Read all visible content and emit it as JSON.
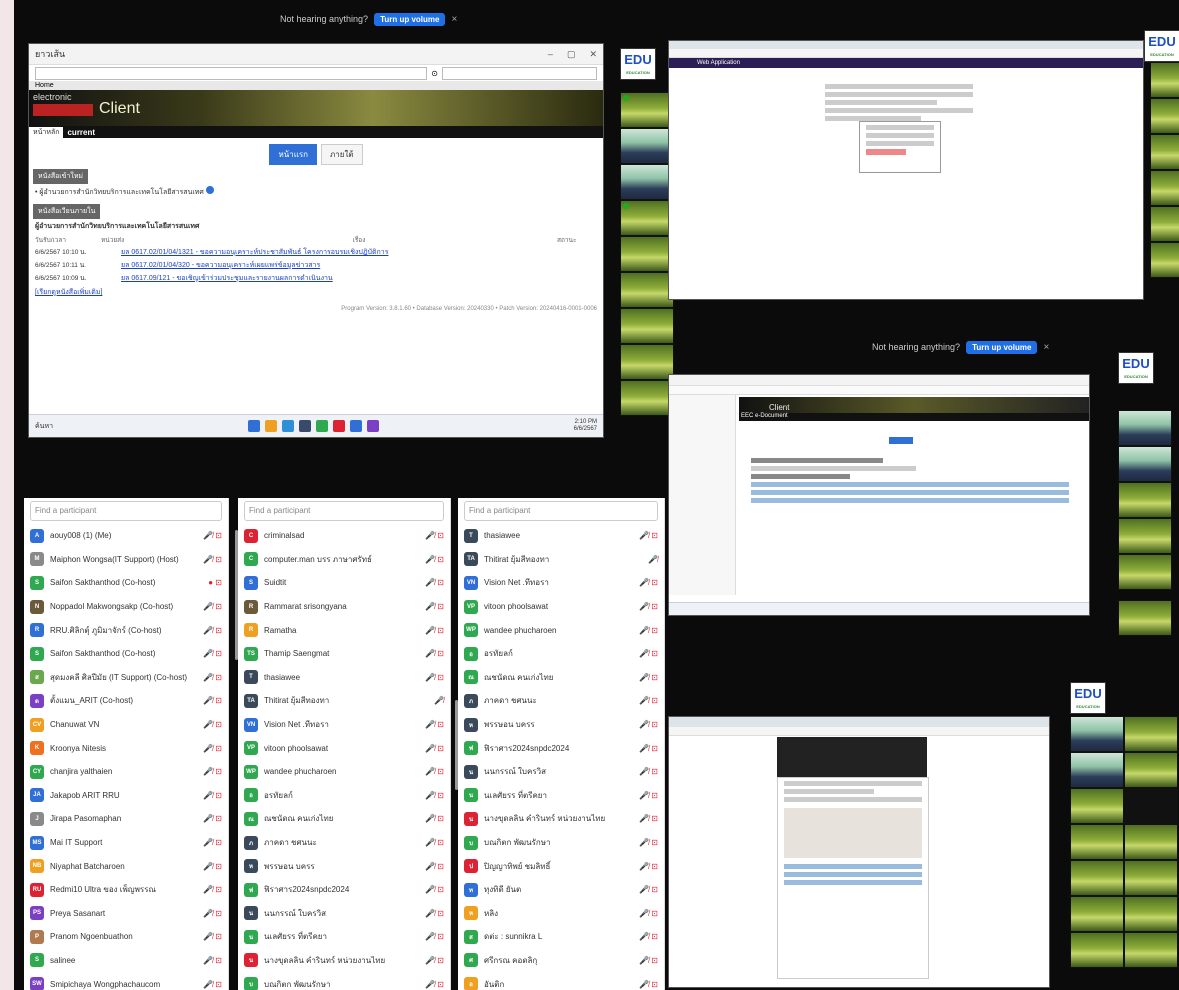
{
  "banner": {
    "text": "Not hearing anything?",
    "button": "Turn up volume",
    "close": "×"
  },
  "main_window": {
    "title": "ยาวเส้น",
    "address_glyph": "⊙",
    "tab_label": "Home",
    "ec_line1": "electronic",
    "ec_line2": "Client",
    "subheader_left": "หน้าหลัก",
    "subheader_right": "current",
    "tab1": "หน้าแรก",
    "tab2": "ภายใต้",
    "section1": "หนังสือเข้าใหม่",
    "notice": "ผู้อำนวยการสำนักวิทยบริการและเทคโนโลยีสารสนเทศ",
    "section2": "หนังสือเวียนภายใน",
    "table_title": "ผู้อำนวยการสำนักวิทยบริการและเทคโนโลยีสารสนเทศ",
    "col_date": "วันรับ/เวลา",
    "col_sender": "หน่วยส่ง",
    "col_subject": "เรื่อง",
    "col_status": "สถานะ",
    "rows": [
      {
        "date": "6/6/2567 10:10 น.",
        "link": "ยล 0617.02/01/04/1321 - ขอความอนุเคราะห์ประชาสัมพันธ์ โครงการอบรมเชิงปฏิบัติการ"
      },
      {
        "date": "6/6/2567 10:11 น.",
        "link": "ยล 0617.02/01/04/320 - ขอความอนุเคราะห์เผยแพร่ข้อมูลข่าวสาร"
      },
      {
        "date": "6/6/2567 10:09 น.",
        "link": "ยล 0617.09/121 - ขอเชิญเข้าร่วมประชุมและรายงานผลการดำเนินงาน"
      }
    ],
    "more_link": "[เรียกดูหนังสือเพิ่มเติม]",
    "version": "Program Version: 3.8.1.60 • Database Version: 20240330 • Patch Version: 20240416-0001-0006",
    "taskbar_search": "ค้นหา",
    "taskbar_time": "2:10 PM",
    "taskbar_date": "6/6/2567"
  },
  "right_window": {
    "header": "Web Application"
  },
  "mid_window": {
    "banner_header": "EEC e-Document",
    "ec_line2": "Client"
  },
  "edu_logo": {
    "text": "EDU",
    "sub": "EDUCATION"
  },
  "participants": {
    "search_placeholder": "Find a participant",
    "col1": [
      {
        "initials": "A",
        "name": "aouy008 (1) (Me)",
        "color": "#2f6fd6",
        "status": "🎤̸ ⊡"
      },
      {
        "initials": "M",
        "name": "Maiphon Wongsa(IT Support) (Host)",
        "color": "#8a8a8a",
        "status": "🎤̸ ⊡"
      },
      {
        "initials": "S",
        "name": "Saifon Sakthanthod (Co-host)",
        "color": "#2fa84f",
        "status": "● ⊡"
      },
      {
        "initials": "N",
        "name": "Noppadol Makwongsakp (Co-host)",
        "color": "#6b5a3a",
        "status": "🎤̸ ⊡"
      },
      {
        "initials": "R",
        "name": "RRU.ศิลิกตุ์ ภูมิมาจักร์ (Co-host)",
        "color": "#2f6fd6",
        "status": "🎤̸ ⊡"
      },
      {
        "initials": "S",
        "name": "Saifon Sakthanthod (Co-host)",
        "color": "#2fa84f",
        "status": "🎤̸ ⊡"
      },
      {
        "initials": "ส",
        "name": "สุดมงคลี ศิลปีมัย (IT Support) (Co-host)",
        "color": "#6aa84f",
        "status": "🎤̸ ⊡"
      },
      {
        "initials": "ต",
        "name": "ตั้งแมน_ARIT (Co-host)",
        "color": "#7b3fc4",
        "status": "🎤̸ ⊡"
      },
      {
        "initials": "CV",
        "name": "Chanuwat VN",
        "color": "#f0a020",
        "status": "🎤̸ ⊡"
      },
      {
        "initials": "K",
        "name": "Kroonya Nitesis",
        "color": "#f07020",
        "status": "🎤̸ ⊡"
      },
      {
        "initials": "CY",
        "name": "chanjira yalthaien",
        "color": "#2fa84f",
        "status": "🎤̸ ⊡"
      },
      {
        "initials": "JA",
        "name": "Jakapob ARIT RRU",
        "color": "#2f6fd6",
        "status": "🎤̸ ⊡"
      },
      {
        "initials": "J",
        "name": "Jirapa Pasomaphan",
        "color": "#8a8a8a",
        "status": "🎤̸ ⊡"
      },
      {
        "initials": "MS",
        "name": "Mai IT Support",
        "color": "#2f6fd6",
        "status": "🎤̸ ⊡"
      },
      {
        "initials": "NB",
        "name": "Niyaphat Batcharoen",
        "color": "#f0a020",
        "status": "🎤̸ ⊡"
      },
      {
        "initials": "RU",
        "name": "Redmi10 Ultra ของ เพ็ญพรรณ",
        "color": "#d23",
        "status": "🎤̸ ⊡"
      },
      {
        "initials": "PS",
        "name": "Preya Sasanart",
        "color": "#7b3fc4",
        "status": "🎤̸ ⊡"
      },
      {
        "initials": "P",
        "name": "Pranom Ngoenbuathon",
        "color": "#b07a50",
        "status": "🎤̸ ⊡"
      },
      {
        "initials": "S",
        "name": "salinee",
        "color": "#2fa84f",
        "status": "🎤̸ ⊡"
      },
      {
        "initials": "SW",
        "name": "Smipichaya Wongphachaucom",
        "color": "#7b3fc4",
        "status": "🎤̸ ⊡"
      }
    ],
    "col2": [
      {
        "initials": "C",
        "name": "criminalsad",
        "color": "#d23",
        "status": "🎤̸ ⊡"
      },
      {
        "initials": "C",
        "name": "computer.man บรร ภาษาศรัทธ์",
        "color": "#2fa84f",
        "status": "🎤̸ ⊡"
      },
      {
        "initials": "S",
        "name": "Suidtit",
        "color": "#2f6fd6",
        "status": "🎤̸ ⊡"
      },
      {
        "initials": "R",
        "name": "Rammarat srisongyana",
        "color": "#6b5a3a",
        "status": "🎤̸ ⊡"
      },
      {
        "initials": "R",
        "name": "Ramatha",
        "color": "#f0a020",
        "status": "🎤̸ ⊡"
      },
      {
        "initials": "TS",
        "name": "Thamip Saengmat",
        "color": "#2fa84f",
        "status": "🎤̸ ⊡"
      },
      {
        "initials": "T",
        "name": "thasiawee",
        "color": "#3a4a5a",
        "status": "🎤̸ ⊡"
      },
      {
        "initials": "TA",
        "name": "Thitirat ยุ้มสีทองทา",
        "color": "#3a4a5a",
        "status": "🎤̸"
      },
      {
        "initials": "VN",
        "name": "Vision Net .ทีทอรา",
        "color": "#2f6fd6",
        "status": "🎤̸ ⊡"
      },
      {
        "initials": "VP",
        "name": "vitoon phoolsawat",
        "color": "#2fa84f",
        "status": "🎤̸ ⊡"
      },
      {
        "initials": "WP",
        "name": "wandee phucharoen",
        "color": "#2fa84f",
        "status": "🎤̸ ⊡"
      },
      {
        "initials": "อ",
        "name": "อรทัยลก์",
        "color": "#2fa84f",
        "status": "🎤̸ ⊡"
      },
      {
        "initials": "ณ",
        "name": "ณชนัดณ คนเก่งไทย",
        "color": "#2fa84f",
        "status": "🎤̸ ⊡"
      },
      {
        "initials": "ภ",
        "name": "ภาคดา ชศนนะ",
        "color": "#3a4a5a",
        "status": "🎤̸ ⊡"
      },
      {
        "initials": "ห",
        "name": "พรรษอน บครร",
        "color": "#3a4a5a",
        "status": "🎤̸ ⊡"
      },
      {
        "initials": "ฟ",
        "name": "ฟิราศาร2024snpdc2024",
        "color": "#2fa84f",
        "status": "🎤̸ ⊡"
      },
      {
        "initials": "น",
        "name": "นนกรรณ์ ใบครวิส",
        "color": "#3a4a5a",
        "status": "🎤̸ ⊡"
      },
      {
        "initials": "น",
        "name": "นเลศัยรร ที่ตรีคยา",
        "color": "#2fa84f",
        "status": "🎤̸ ⊡"
      },
      {
        "initials": "น",
        "name": "นางขุดลลิน คำรินทร์ หน่วยงานไทย",
        "color": "#d23",
        "status": "🎤̸ ⊡"
      },
      {
        "initials": "บ",
        "name": "บณกิตก พัฒนรักษา",
        "color": "#2fa84f",
        "status": "🎤̸ ⊡"
      }
    ],
    "col3": [
      {
        "initials": "T",
        "name": "thasiawee",
        "color": "#3a4a5a",
        "status": "🎤̸ ⊡"
      },
      {
        "initials": "TA",
        "name": "Thitirat ยุ้มสีทองทา",
        "color": "#3a4a5a",
        "status": "🎤̸"
      },
      {
        "initials": "VN",
        "name": "Vision Net .ทีทอรา",
        "color": "#2f6fd6",
        "status": "🎤̸ ⊡"
      },
      {
        "initials": "VP",
        "name": "vitoon phoolsawat",
        "color": "#2fa84f",
        "status": "🎤̸ ⊡"
      },
      {
        "initials": "WP",
        "name": "wandee phucharoen",
        "color": "#2fa84f",
        "status": "🎤̸ ⊡"
      },
      {
        "initials": "อ",
        "name": "อรทัยลก์",
        "color": "#2fa84f",
        "status": "🎤̸ ⊡"
      },
      {
        "initials": "ณ",
        "name": "ณชนัดณ คนเก่งไทย",
        "color": "#2fa84f",
        "status": "🎤̸ ⊡"
      },
      {
        "initials": "ภ",
        "name": "ภาคดา ชศนนะ",
        "color": "#3a4a5a",
        "status": "🎤̸ ⊡"
      },
      {
        "initials": "ห",
        "name": "พรรษอน บครร",
        "color": "#3a4a5a",
        "status": "🎤̸ ⊡"
      },
      {
        "initials": "ฟ",
        "name": "ฟิราศาร2024snpdc2024",
        "color": "#2fa84f",
        "status": "🎤̸ ⊡"
      },
      {
        "initials": "น",
        "name": "นนกรรณ์ ใบครวิส",
        "color": "#3a4a5a",
        "status": "🎤̸ ⊡"
      },
      {
        "initials": "น",
        "name": "นเลศัยรร ที่ตรีคยา",
        "color": "#2fa84f",
        "status": "🎤̸ ⊡"
      },
      {
        "initials": "น",
        "name": "นางขุดลลิน คำรินทร์ หน่วยงานไทย",
        "color": "#d23",
        "status": "🎤̸ ⊡"
      },
      {
        "initials": "บ",
        "name": "บณกิตก พัฒนรักษา",
        "color": "#2fa84f",
        "status": "🎤̸ ⊡"
      },
      {
        "initials": "ป",
        "name": "ปิญญาทิพย์ ชมลิทธิ์",
        "color": "#d23",
        "status": "🎤̸ ⊡"
      },
      {
        "initials": "ท",
        "name": "ทุงทิดี ยันต",
        "color": "#2f6fd6",
        "status": "🎤̸ ⊡"
      },
      {
        "initials": "ห",
        "name": "หลิง",
        "color": "#f0a020",
        "status": "🎤̸ ⊡"
      },
      {
        "initials": "ส",
        "name": "ดต่ะ : sunnikra L",
        "color": "#2fa84f",
        "status": "🎤̸ ⊡"
      },
      {
        "initials": "ศ",
        "name": "ศรีกรณ คอดลิกุ",
        "color": "#2fa84f",
        "status": "🎤̸ ⊡"
      },
      {
        "initials": "อ",
        "name": "อันติก",
        "color": "#f0a020",
        "status": "🎤̸ ⊡"
      }
    ]
  }
}
